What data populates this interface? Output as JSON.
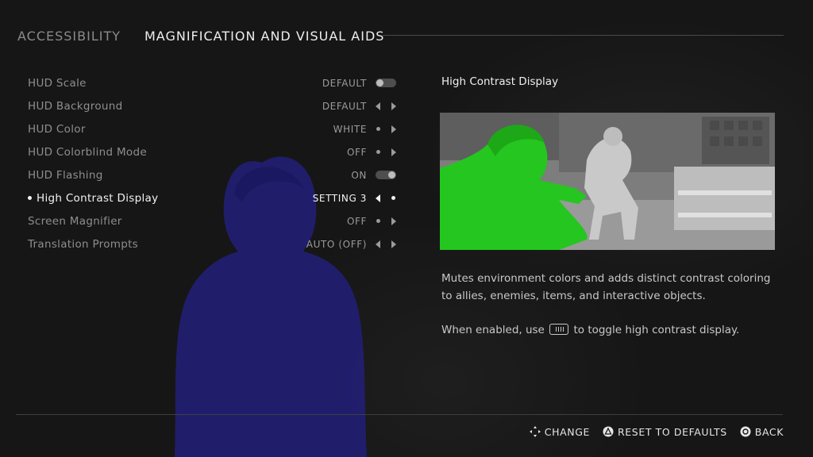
{
  "header": {
    "parent": "ACCESSIBILITY",
    "title": "MAGNIFICATION AND VISUAL AIDS"
  },
  "settings": [
    {
      "label": "HUD Scale",
      "value": "DEFAULT",
      "control": "toggle-off"
    },
    {
      "label": "HUD Background",
      "value": "DEFAULT",
      "control": "arrows"
    },
    {
      "label": "HUD Color",
      "value": "WHITE",
      "control": "dot-arrow"
    },
    {
      "label": "HUD Colorblind Mode",
      "value": "OFF",
      "control": "dot-arrow"
    },
    {
      "label": "HUD Flashing",
      "value": "ON",
      "control": "toggle-on"
    },
    {
      "label": "High Contrast Display",
      "value": "SETTING 3",
      "control": "arrow-dot",
      "selected": true
    },
    {
      "label": "Screen Magnifier",
      "value": "OFF",
      "control": "dot-arrow"
    },
    {
      "label": "Translation Prompts",
      "value": "AUTO (OFF)",
      "control": "arrows"
    }
  ],
  "detail": {
    "title": "High Contrast Display",
    "description_1": "Mutes environment colors and adds distinct contrast coloring to allies, enemies, items, and interactive objects.",
    "description_2_prefix": "When enabled, use",
    "description_2_icon": "touchpad-button-icon",
    "description_2_suffix": "to toggle high contrast display."
  },
  "footer": {
    "change": "CHANGE",
    "reset": "RESET TO DEFAULTS",
    "back": "BACK"
  },
  "colors": {
    "ally_highlight": "#22c71c",
    "companion_highlight": "#2a2a9e",
    "text_primary": "#f2f2f2",
    "text_muted": "#8e8e8e"
  }
}
